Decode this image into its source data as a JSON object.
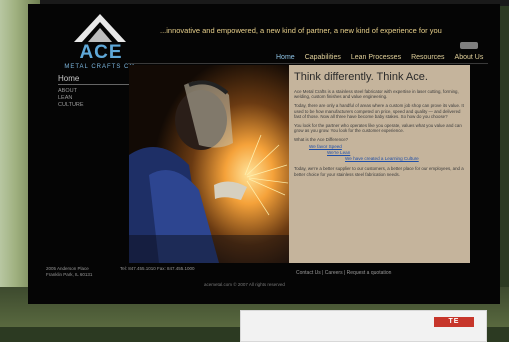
{
  "logo": {
    "word": "ACE",
    "subtitle": "METAL CRAFTS CO."
  },
  "header": {
    "tagline": "...innovative and empowered, a new kind of partner, a new kind of experience for you"
  },
  "nav": {
    "items": [
      {
        "label": "Home"
      },
      {
        "label": "Capabilities"
      },
      {
        "label": "Lean Processes"
      },
      {
        "label": "Resources"
      },
      {
        "label": "About Us"
      }
    ]
  },
  "sidebar": {
    "title": "Home",
    "links": [
      "ABOUT",
      "LEAN",
      "CULTURE"
    ]
  },
  "content": {
    "headline": "Think differently. Think Ace.",
    "p1": "Ace Metal Crafts is a stainless steel fabricator with expertise in laser cutting, forming, welding, custom finishes and value engineering.",
    "p2": "Today, there are only a handful of areas where a custom job shop can prove its value. It used to be how manufacturers competed on price, speed and quality — and delivered fast of those. Now all three have become baby stakes. So how do you choose?",
    "p3": "You look for the partner who operates like you operate, values what you value and can grow as you grow. You look for the customer experience.",
    "question": "What is the Ace Difference?",
    "links": [
      "We favor Speed",
      "We're Lean",
      "We have created a Learning Culture"
    ],
    "p4": "Today, we're a better supplier to our customers, a better place for our employees, and a better choice for your stainless steel fabrication needs."
  },
  "footer": {
    "address_line1": "2005 Anderson Place",
    "address_line2": "Franklin Park, IL 60131",
    "phone": "Tel: 847.455.1010   Fax: 847.455.1000",
    "links": "Contact Us  |  Careers  |  Request a quotation",
    "copyright": "acemetal.com © 2007 All rights reserved"
  },
  "colors": {
    "accent_blue": "#5fa8d8",
    "nav_gold": "#e2d19b",
    "content_tan": "#c5b49c",
    "screen_black": "#050505"
  }
}
